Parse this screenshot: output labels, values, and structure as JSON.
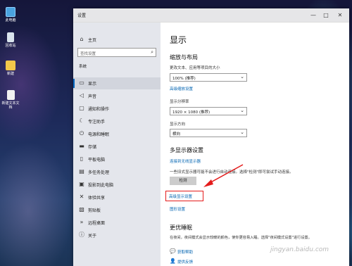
{
  "desktop": {
    "icons": [
      {
        "label": "此电脑"
      },
      {
        "label": "回收站"
      },
      {
        "label": "新建"
      },
      {
        "label": "新建文本文档"
      }
    ]
  },
  "window": {
    "title": "设置",
    "controls": {
      "minimize": "—",
      "maximize": "□",
      "close": "✕"
    }
  },
  "sidebar": {
    "home": "主页",
    "search_placeholder": "查找设置",
    "section": "系统",
    "items": [
      {
        "label": "显示",
        "active": true
      },
      {
        "label": "声音"
      },
      {
        "label": "通知和操作"
      },
      {
        "label": "专注助手"
      },
      {
        "label": "电源和睡眠"
      },
      {
        "label": "存储"
      },
      {
        "label": "平板电脑"
      },
      {
        "label": "多任务处理"
      },
      {
        "label": "投影到此电脑"
      },
      {
        "label": "体验共享"
      },
      {
        "label": "剪贴板"
      },
      {
        "label": "远程桌面"
      },
      {
        "label": "关于"
      }
    ]
  },
  "main": {
    "title": "显示",
    "scale_section": "缩放与布局",
    "scale_label": "更改文本、应用等项目的大小",
    "scale_value": "100% (推荐)",
    "advanced_scale_link": "高级缩放设置",
    "resolution_label": "显示分辨率",
    "resolution_value": "1920 × 1080 (推荐)",
    "orientation_label": "显示方向",
    "orientation_value": "横向",
    "multi_section": "多显示器设置",
    "wireless_link": "连接到无线显示器",
    "detect_desc": "一些旧式显示器可能不会进行自动连接。选择\"检测\"即可尝试手动连接。",
    "detect_button": "检测",
    "advanced_display_link": "高级显示设置",
    "graphics_link": "图形设置",
    "sleep_section": "更优睡眠",
    "sleep_desc": "在夜间，夜间模式会显示较暖的颜色，使你更容易入睡。选择\"夜间模式设置\"进行设置。",
    "help_link": "获取帮助",
    "feedback_link": "提供反馈"
  },
  "watermark": "jingyan.baidu.com",
  "colors": {
    "accent": "#0063b1",
    "annotation": "#e41b1b"
  }
}
